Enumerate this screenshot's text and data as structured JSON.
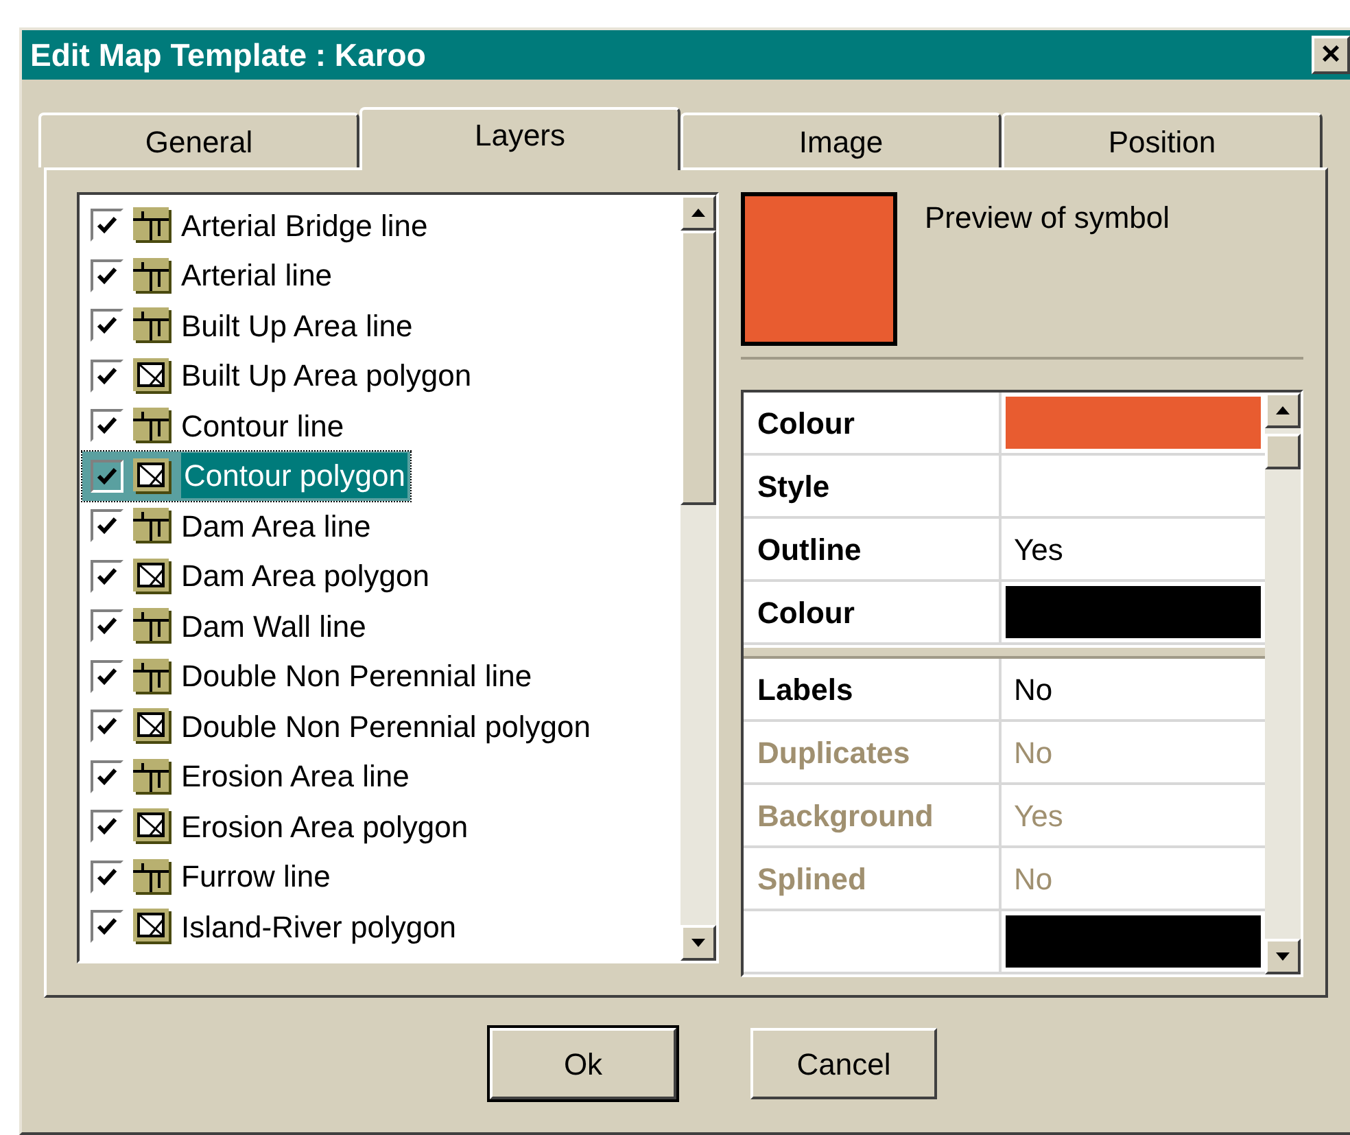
{
  "window": {
    "title": "Edit Map Template : Karoo",
    "close": "×"
  },
  "tabs": [
    {
      "label": "General",
      "selected": false
    },
    {
      "label": "Layers",
      "selected": true
    },
    {
      "label": "Image",
      "selected": false
    },
    {
      "label": "Position",
      "selected": false
    }
  ],
  "layers": [
    {
      "label": "Arterial Bridge line",
      "kind": "line",
      "checked": true,
      "selected": false
    },
    {
      "label": "Arterial line",
      "kind": "line",
      "checked": true,
      "selected": false
    },
    {
      "label": "Built Up Area line",
      "kind": "line",
      "checked": true,
      "selected": false
    },
    {
      "label": "Built Up Area polygon",
      "kind": "polygon",
      "checked": true,
      "selected": false
    },
    {
      "label": "Contour line",
      "kind": "line",
      "checked": true,
      "selected": false
    },
    {
      "label": "Contour polygon",
      "kind": "polygon",
      "checked": true,
      "selected": true
    },
    {
      "label": "Dam Area line",
      "kind": "line",
      "checked": true,
      "selected": false
    },
    {
      "label": "Dam Area polygon",
      "kind": "polygon",
      "checked": true,
      "selected": false
    },
    {
      "label": "Dam Wall line",
      "kind": "line",
      "checked": true,
      "selected": false
    },
    {
      "label": "Double Non Perennial line",
      "kind": "line",
      "checked": true,
      "selected": false
    },
    {
      "label": "Double Non Perennial polygon",
      "kind": "polygon",
      "checked": true,
      "selected": false
    },
    {
      "label": "Erosion Area line",
      "kind": "line",
      "checked": true,
      "selected": false
    },
    {
      "label": "Erosion Area polygon",
      "kind": "polygon",
      "checked": true,
      "selected": false
    },
    {
      "label": "Furrow line",
      "kind": "line",
      "checked": true,
      "selected": false
    },
    {
      "label": "Island-River polygon",
      "kind": "polygon",
      "checked": true,
      "selected": false
    }
  ],
  "preview": {
    "color": "#e85c30",
    "label": "Preview of symbol"
  },
  "properties": [
    {
      "kind": "colour",
      "label": "Colour",
      "color": "#e85c30",
      "disabled": false
    },
    {
      "kind": "text",
      "label": "Style",
      "disabled": false
    },
    {
      "kind": "text",
      "label": "Outline",
      "value": "Yes",
      "disabled": false
    },
    {
      "kind": "colour",
      "label": "Colour",
      "color": "#000000",
      "disabled": false
    },
    {
      "kind": "separator"
    },
    {
      "kind": "text",
      "label": "Labels",
      "value": "No",
      "disabled": false
    },
    {
      "kind": "text",
      "label": "Duplicates",
      "value": "No",
      "disabled": true
    },
    {
      "kind": "text",
      "label": "Background",
      "value": "Yes",
      "disabled": true
    },
    {
      "kind": "text",
      "label": "Splined",
      "value": "No",
      "disabled": true
    },
    {
      "kind": "colour",
      "color": "#000000"
    }
  ],
  "buttons": [
    "Ok",
    "Cancel"
  ]
}
